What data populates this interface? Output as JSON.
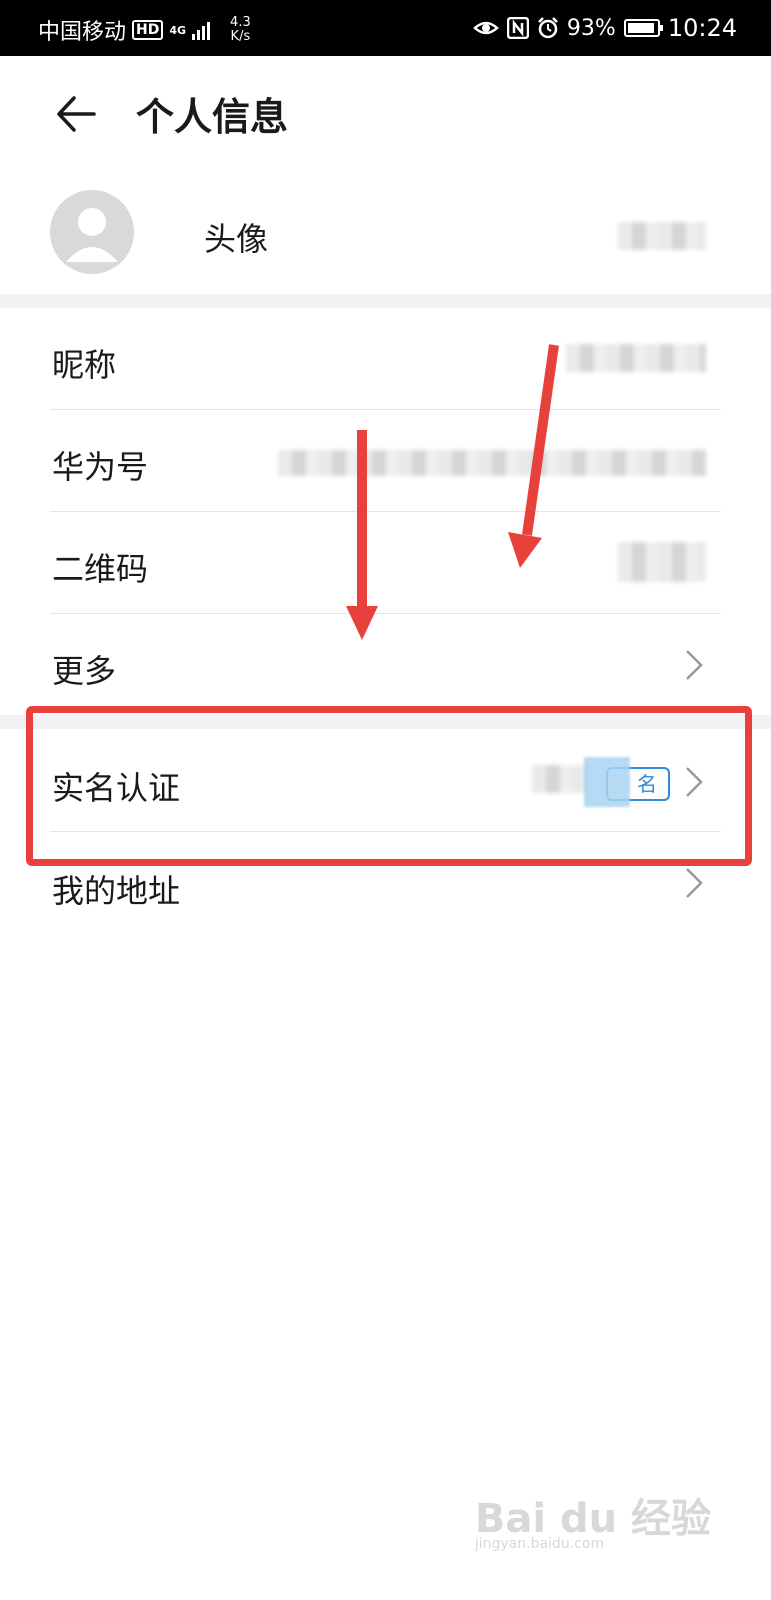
{
  "status_bar": {
    "carrier": "中国移动",
    "hd": "HD",
    "network": "4G",
    "speed_value": "4.3",
    "speed_unit": "K/s",
    "battery_text": "93%",
    "battery_level": 0.93,
    "time": "10:24"
  },
  "header": {
    "title": "个人信息"
  },
  "profile": {
    "avatar_label": "头像"
  },
  "items": [
    {
      "label": "昵称"
    },
    {
      "label": "华为号"
    },
    {
      "label": "二维码"
    },
    {
      "label": "更多"
    },
    {
      "label": "实名认证",
      "badge": "名"
    },
    {
      "label": "我的地址"
    }
  ],
  "colors": {
    "annotation": "#e8413c",
    "badge": "#2f8ad8"
  },
  "watermark": {
    "brand": "Bai du 经验",
    "url": "jingyan.baidu.com"
  }
}
